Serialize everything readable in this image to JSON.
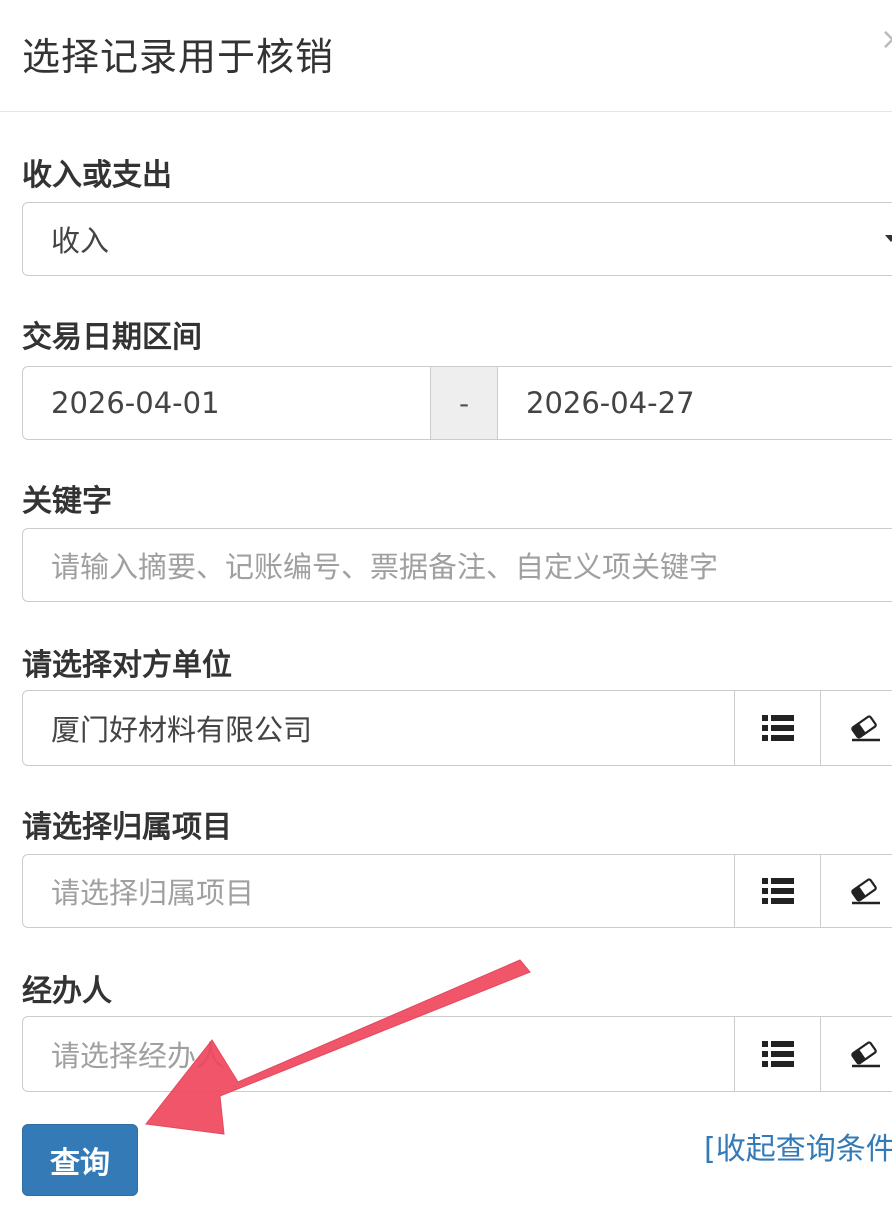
{
  "dialog": {
    "title": "选择记录用于核销",
    "close_symbol": "×"
  },
  "form": {
    "type": {
      "label": "收入或支出",
      "selected": "收入"
    },
    "date_range": {
      "label": "交易日期区间",
      "start": "2026-04-01",
      "separator": "-",
      "end": "2026-04-27"
    },
    "keyword": {
      "label": "关键字",
      "placeholder": "请输入摘要、记账编号、票据备注、自定义项关键字"
    },
    "counterparty": {
      "label": "请选择对方单位",
      "value": "厦门好材料有限公司"
    },
    "project": {
      "label": "请选择归属项目",
      "placeholder": "请选择归属项目"
    },
    "handler": {
      "label": "经办人",
      "placeholder": "请选择经办人"
    }
  },
  "actions": {
    "query_label": "查询",
    "collapse_label": "[收起查询条件"
  },
  "icons": {
    "list": "list-icon",
    "clear": "eraser-icon",
    "dropdown": "caret-down-icon"
  },
  "colors": {
    "primary": "#337ab7",
    "annotation_arrow": "#f0475e"
  }
}
